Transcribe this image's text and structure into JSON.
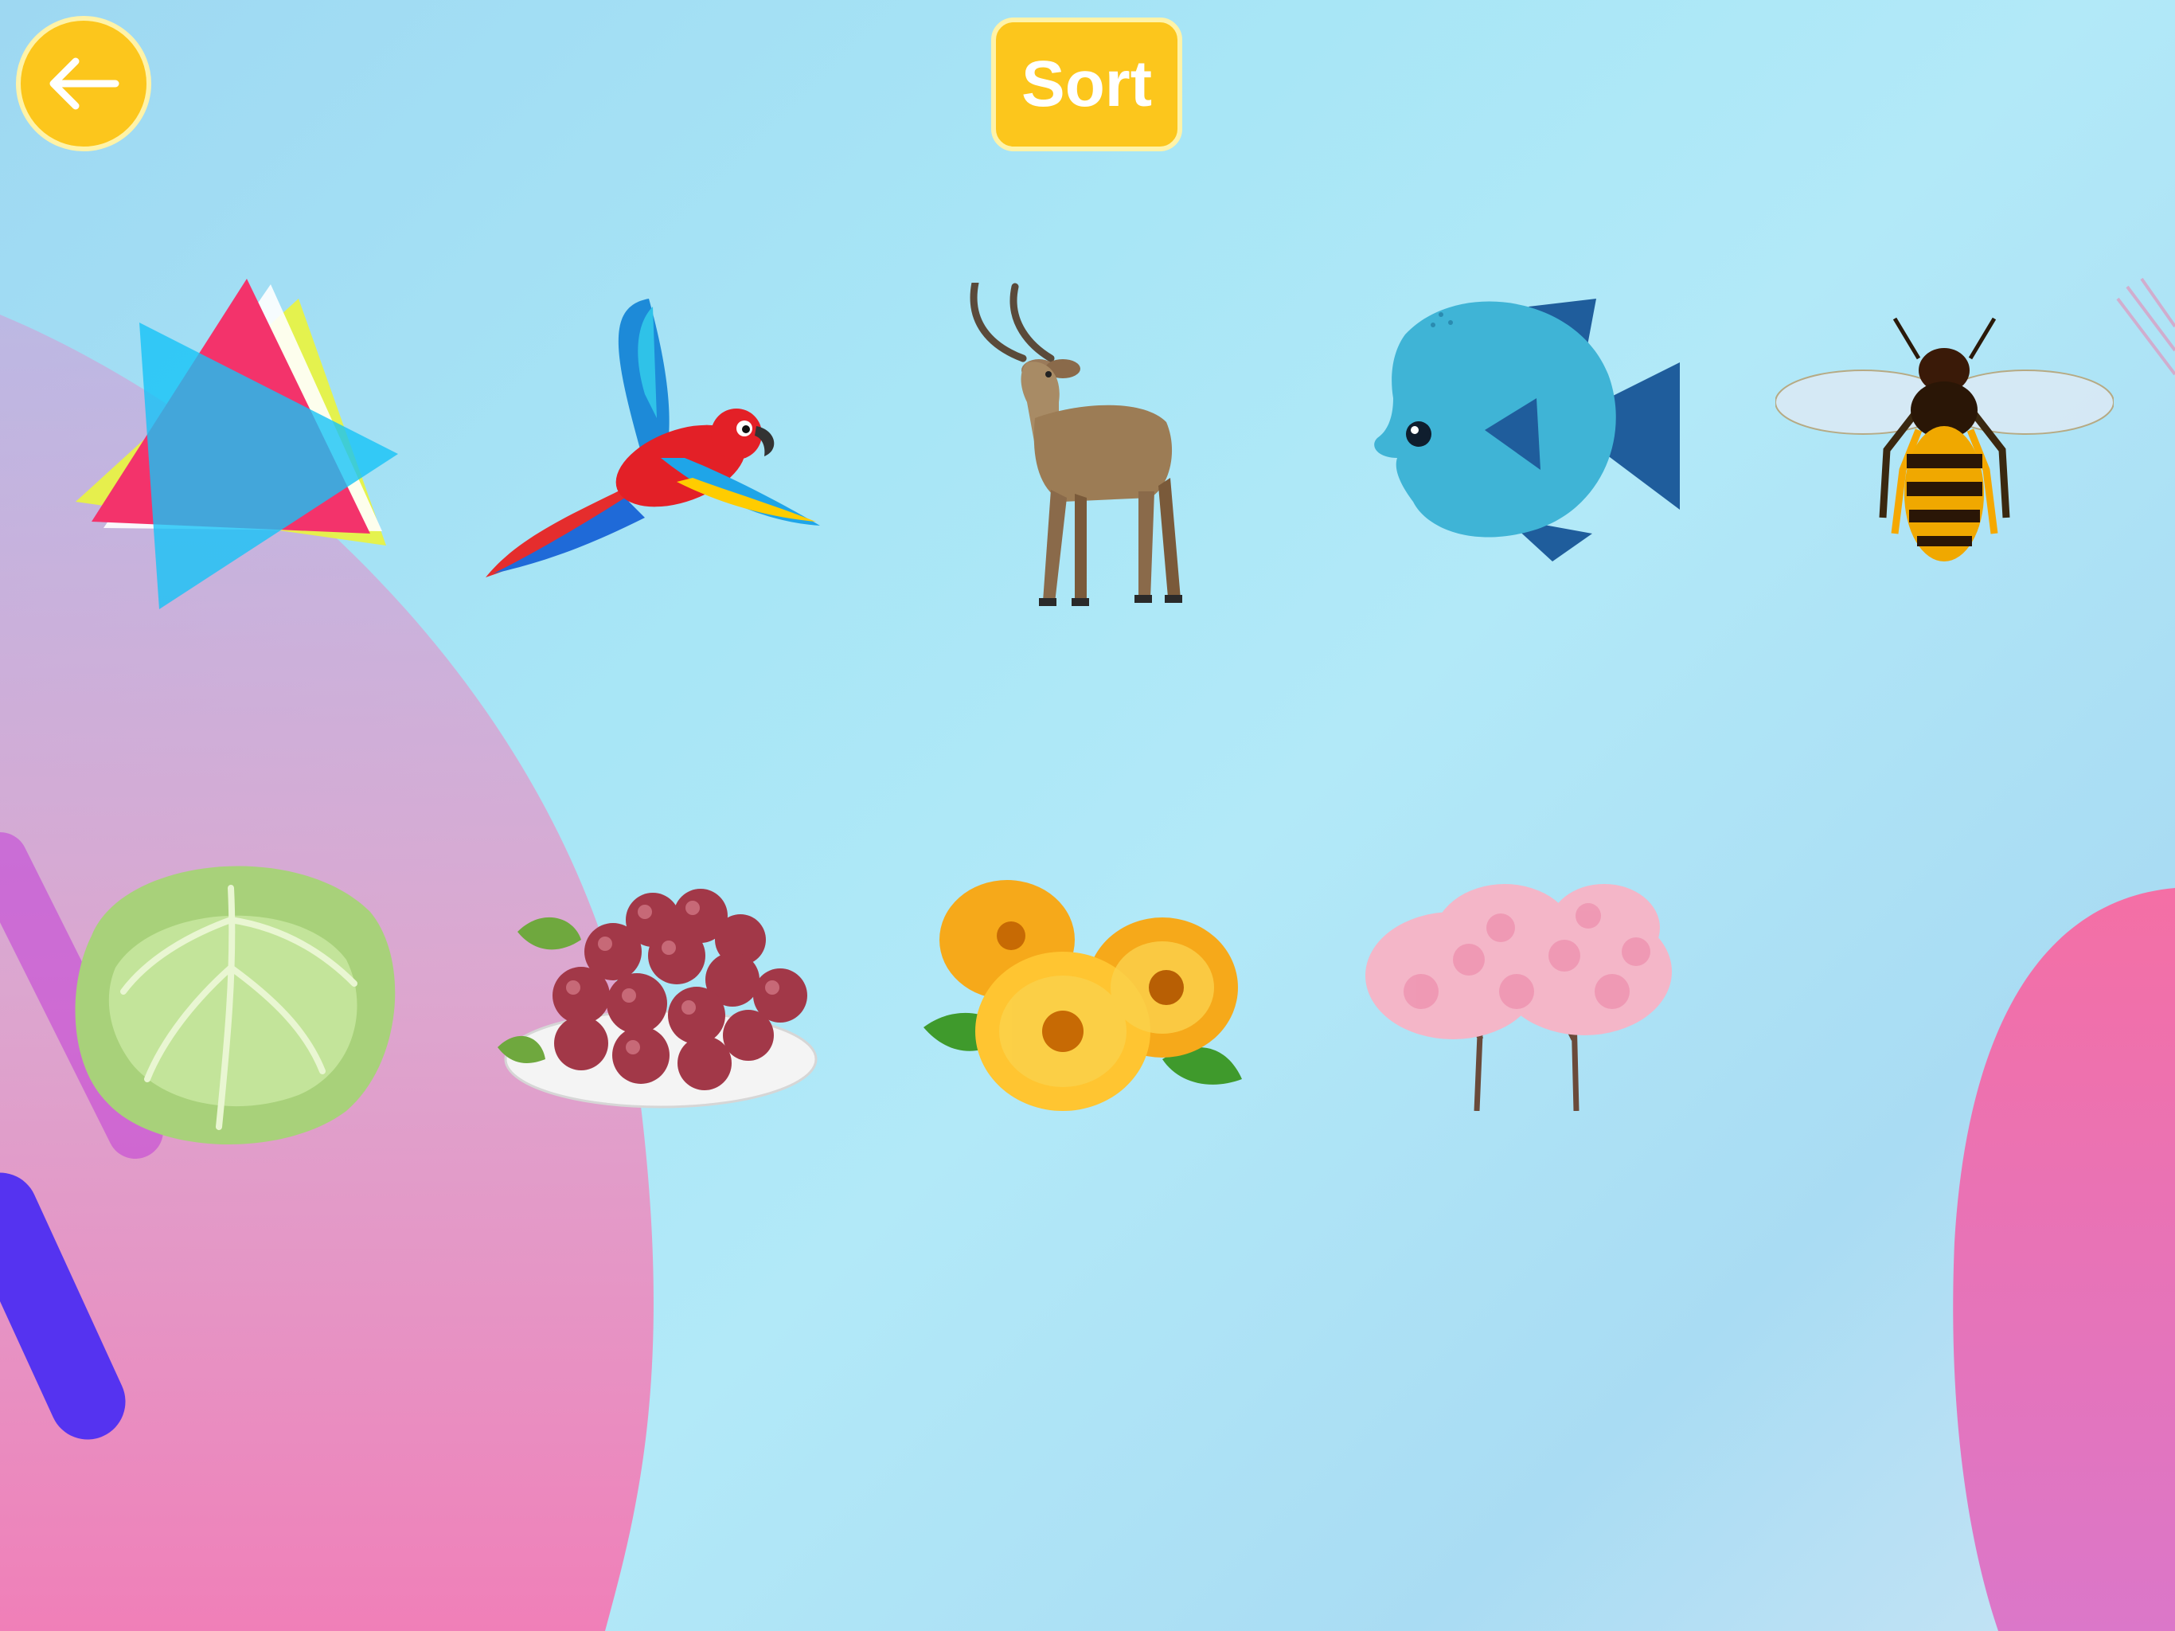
{
  "header": {
    "back_icon": "arrow-left-icon",
    "sort_label": "Sort"
  },
  "colors": {
    "button_yellow": "#fcc61c",
    "button_border": "#fff3a8",
    "background_blue": "#a8e6f6",
    "decor_pink": "#f07fc1",
    "decor_purple": "#5a3bf2"
  },
  "cards": [
    {
      "name": "triangles-card",
      "icon": "triangles-icon"
    },
    {
      "name": "parrot-card",
      "icon": "parrot-icon"
    },
    {
      "name": "antelope-card",
      "icon": "antelope-icon"
    },
    {
      "name": "fish-card",
      "icon": "fish-icon"
    },
    {
      "name": "bee-card",
      "icon": "bee-icon"
    },
    {
      "name": "cabbage-card",
      "icon": "cabbage-icon"
    },
    {
      "name": "grapes-card",
      "icon": "grapes-icon"
    },
    {
      "name": "flowers-card",
      "icon": "flowers-icon"
    },
    {
      "name": "cherry-blossom-trees-card",
      "icon": "cherry-blossom-trees-icon"
    }
  ]
}
